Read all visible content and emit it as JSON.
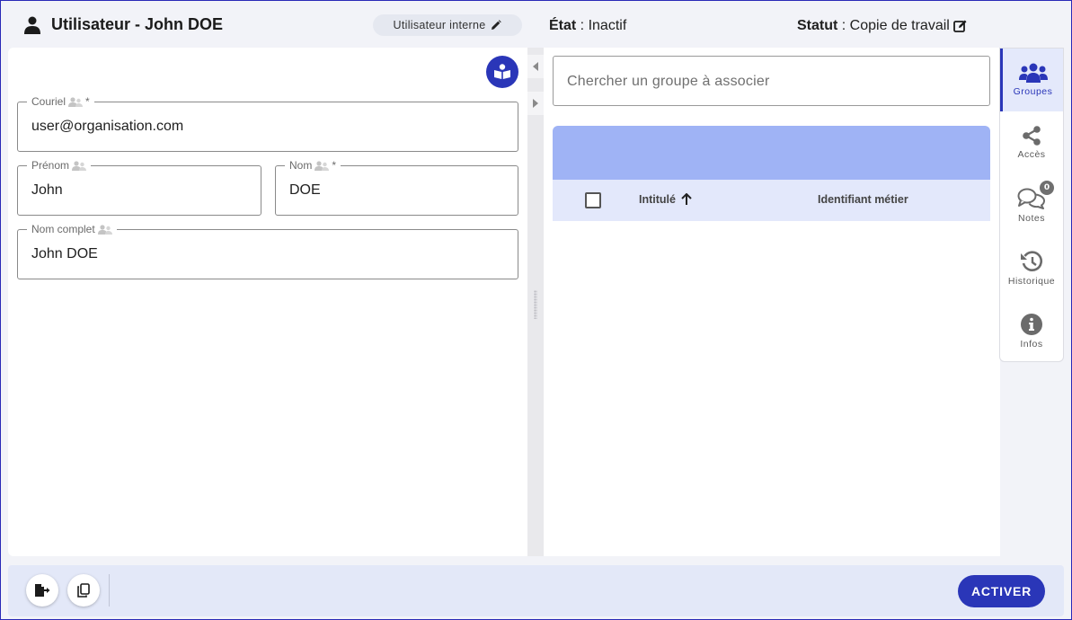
{
  "header": {
    "title": "Utilisateur - John DOE",
    "chip_label": "Utilisateur interne",
    "etat_label": "État",
    "etat_value": " : Inactif",
    "statut_label": "Statut",
    "statut_value": " : Copie de travail"
  },
  "form": {
    "email": {
      "label": "Couriel",
      "required_mark": "*",
      "value": "user@organisation.com"
    },
    "prenom": {
      "label": "Prénom",
      "value": "John"
    },
    "nom": {
      "label": "Nom",
      "required_mark": "*",
      "value": "DOE"
    },
    "nom_complet": {
      "label": "Nom complet",
      "value": "John DOE"
    }
  },
  "groups": {
    "search_placeholder": "Chercher un groupe à associer",
    "columns": [
      "Intitulé",
      "Identifiant métier"
    ]
  },
  "side_tabs": [
    {
      "label": "Groupes",
      "icon": "users-icon",
      "active": true
    },
    {
      "label": "Accès",
      "icon": "share-icon"
    },
    {
      "label": "Notes",
      "icon": "comments-icon",
      "badge": "0"
    },
    {
      "label": "Historique",
      "icon": "history-icon"
    },
    {
      "label": "Infos",
      "icon": "info-icon"
    }
  ],
  "footer": {
    "activate_label": "ACTIVER"
  },
  "colors": {
    "primary": "#2a36b8",
    "table_banner": "#9fb3f5",
    "table_header": "#e3e8fb",
    "bottom_bar": "#e3e8f8"
  }
}
